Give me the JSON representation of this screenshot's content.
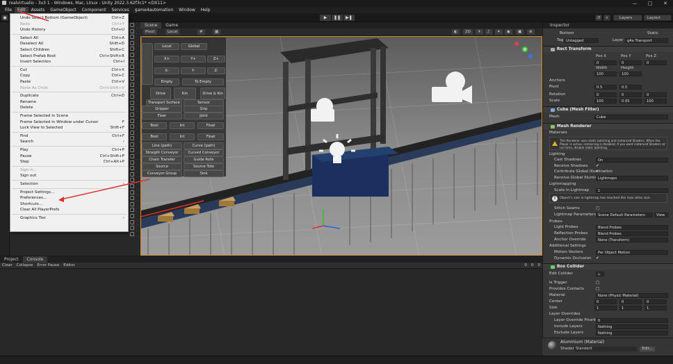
{
  "window": {
    "title": "realvirtualio - 3x3 1 - Windows, Mac, Linux - Unity 2022.3.62f3c1* <DX11>",
    "min": "—",
    "max": "□",
    "close": "✕"
  },
  "menubar": [
    "File",
    "Edit",
    "Assets",
    "GameObject",
    "Component",
    "Services",
    "game4automation",
    "Window",
    "Help"
  ],
  "toolbar": {
    "play": "▶",
    "pause": "❚❚",
    "step": "▶❚",
    "layers": "Layers",
    "layout": "Layout"
  },
  "edit_menu": [
    {
      "label": "Undo Select Bottom (GameObject)",
      "key": "Ctrl+Z",
      "dis": false
    },
    {
      "label": "Redo",
      "key": "Ctrl+Y",
      "dis": true
    },
    {
      "label": "Undo History",
      "key": "Ctrl+U",
      "dis": false
    },
    {
      "sep": true
    },
    {
      "label": "Select All",
      "key": "Ctrl+A",
      "dis": false
    },
    {
      "label": "Deselect All",
      "key": "Shift+D",
      "dis": false
    },
    {
      "label": "Select Children",
      "key": "Shift+C",
      "dis": false
    },
    {
      "label": "Select Prefab Root",
      "key": "Ctrl+Shift+R",
      "dis": false
    },
    {
      "label": "Invert Selection",
      "key": "Ctrl+I",
      "dis": false
    },
    {
      "sep": true
    },
    {
      "label": "Cut",
      "key": "Ctrl+X",
      "dis": false
    },
    {
      "label": "Copy",
      "key": "Ctrl+C",
      "dis": false
    },
    {
      "label": "Paste",
      "key": "Ctrl+V",
      "dis": false
    },
    {
      "label": "Paste As Child",
      "key": "Ctrl+Shift+V",
      "dis": true
    },
    {
      "sep": true
    },
    {
      "label": "Duplicate",
      "key": "Ctrl+D",
      "dis": false
    },
    {
      "label": "Rename",
      "key": "",
      "dis": false
    },
    {
      "label": "Delete",
      "key": "",
      "dis": false
    },
    {
      "sep": true
    },
    {
      "label": "Frame Selected in Scene",
      "key": "",
      "dis": false
    },
    {
      "label": "Frame Selected in Window under Cursor",
      "key": "F",
      "dis": false
    },
    {
      "label": "Lock View to Selected",
      "key": "Shift+F",
      "dis": false
    },
    {
      "sep": true
    },
    {
      "label": "Find",
      "key": "Ctrl+F",
      "dis": false
    },
    {
      "label": "Search",
      "key": "›",
      "dis": false
    },
    {
      "sep": true
    },
    {
      "label": "Play",
      "key": "Ctrl+P",
      "dis": false
    },
    {
      "label": "Pause",
      "key": "Ctrl+Shift+P",
      "dis": false
    },
    {
      "label": "Step",
      "key": "Ctrl+Alt+P",
      "dis": false
    },
    {
      "sep": true
    },
    {
      "label": "Sign in...",
      "key": "",
      "dis": true
    },
    {
      "label": "Sign out",
      "key": "",
      "dis": false
    },
    {
      "sep": true
    },
    {
      "label": "Selection",
      "key": "›",
      "dis": false
    },
    {
      "sep": true
    },
    {
      "label": "Project Settings...",
      "key": "",
      "dis": false
    },
    {
      "label": "Preferences...",
      "key": "",
      "dis": false
    },
    {
      "label": "Shortcuts...",
      "key": "",
      "dis": false
    },
    {
      "label": "Clear All PlayerPrefs",
      "key": "",
      "dis": false
    },
    {
      "sep": true
    },
    {
      "label": "Graphics Tier",
      "key": "›",
      "dis": false
    }
  ],
  "scene": {
    "tabs": [
      "Scene",
      "Game"
    ],
    "pivot": "Pivot",
    "local": "Local",
    "persp": "2D"
  },
  "overlay": {
    "buttons": [
      "Local",
      "Global",
      "X+",
      "Y+",
      "Z+",
      "X-",
      "Y-",
      "Z-",
      "Empty",
      "To Empty",
      "Drive",
      "Kin",
      "Drive & Kin",
      "Transport Surface",
      "Sensor",
      "Gripper",
      "Grip",
      "Fixer",
      "Joint",
      "Bool",
      "Int",
      "Float",
      "Bool",
      "Int",
      "Float",
      "Line (path)",
      "Curve (path)",
      "Straight Conveyor",
      "Curved Conveyor",
      "Chain Transfer",
      "Guide Rolls",
      "Source",
      "Source Tote",
      "Conveyor Group",
      "Sink"
    ]
  },
  "bottom": {
    "tabs": [
      "Project",
      "Console"
    ],
    "tools": [
      "Clear",
      "Collapse",
      "Error Pause",
      "Editor"
    ],
    "counts": [
      "0",
      "0",
      "0"
    ]
  },
  "inspector": {
    "tab": "Inspector",
    "object": "Bottom",
    "static": "Static",
    "tag_label": "Tag",
    "tag": "Untagged",
    "layer_label": "Layer",
    "layer": "g4a Transport",
    "rect": "Rect Transform",
    "posx": "Pos X",
    "posy": "Pos Y",
    "posz": "Pos Z",
    "px": "0",
    "py": "0",
    "pz": "0",
    "w_label": "Width",
    "h_label": "Height",
    "w": "100",
    "h": "100",
    "anchors": "Anchors",
    "pivot": "Pivot",
    "pivx": "0.5",
    "pivy": "0.5",
    "rotation": "Rotation",
    "rx": "0",
    "ry": "0",
    "rz": "0",
    "scale": "Scale",
    "sx": "100",
    "sy": "0.05",
    "sz": "100",
    "meshfilter": "Cube (Mesh Filter)",
    "mesh_label": "Mesh",
    "mesh": "Cube",
    "renderer": "Mesh Renderer",
    "materials": "Materials",
    "warn": "This Renderer uses static batching and instanced Shaders. When the Player is active, instancing is disabled. If you want instanced Shaders at run time, disable static batching.",
    "lighting": "Lighting",
    "cast": "Cast Shadows",
    "cast_v": "On",
    "receive": "Receive Shadows",
    "contribute": "Contribute Global Illumination",
    "receive_gi": "Receive Global Illumination",
    "receive_gi_v": "Lightmaps",
    "lightmapping": "Lightmapping",
    "scale_lm": "Scale In Lightmap",
    "scale_lm_v": "1",
    "info": "Object's size in lightmap has reached the max atlas size.",
    "stitch": "Stitch Seams",
    "lm_params": "Lightmap Parameters",
    "lm_params_v": "Scene Default Parameters",
    "view": "View",
    "probes": "Probes",
    "light_probes": "Light Probes",
    "light_probes_v": "Blend Probes",
    "refl": "Reflection Probes",
    "refl_v": "Blend Probes",
    "anchor_ov": "Anchor Override",
    "anchor_ov_v": "None (Transform)",
    "additional": "Additional Settings",
    "motion": "Motion Vectors",
    "motion_v": "Per Object Motion",
    "dyn_occ": "Dynamic Occlusion",
    "box": "Box Collider",
    "edit_col": "Edit Collider",
    "is_trigger": "Is Trigger",
    "provides": "Provides Contacts",
    "material": "Material",
    "material_v": "None (Physic Material)",
    "center": "Center",
    "cx": "0",
    "cy": "0",
    "cz": "0",
    "size": "Size",
    "szx": "1",
    "szy": "1",
    "szz": "1",
    "layer_ov": "Layer Overrides",
    "lop": "Layer Override Priority",
    "lop_v": "0",
    "include": "Include Layers",
    "include_v": "Nothing",
    "exclude": "Exclude Layers",
    "exclude_v": "Nothing",
    "mat_name": "Aluminium (Material)",
    "shader": "Shader",
    "shader_v": "Standard",
    "edit": "Edit..."
  },
  "colors": {
    "accent": "#d68a2a",
    "arrow": "#e03030"
  }
}
